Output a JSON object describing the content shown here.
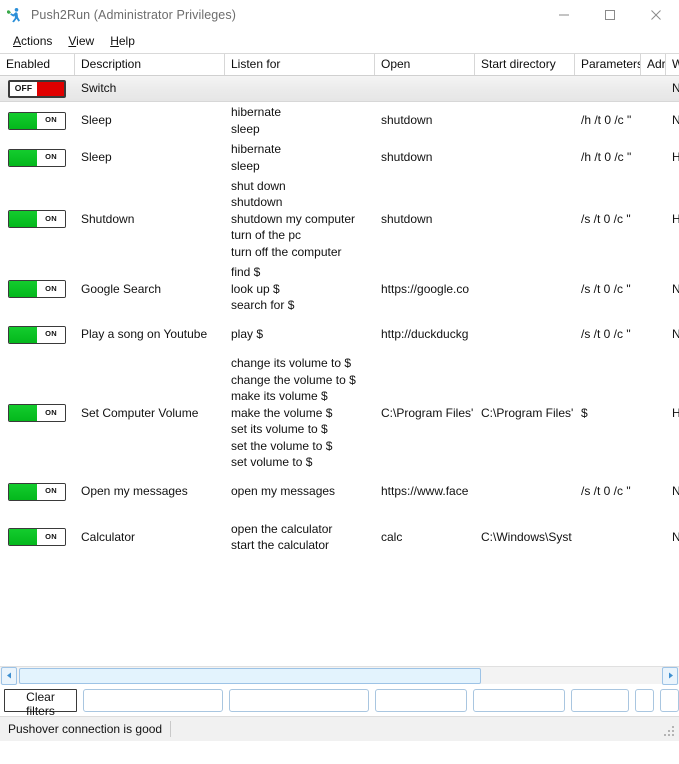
{
  "window": {
    "title": "Push2Run (Administrator Privileges)",
    "icon": "running-person-icon",
    "minimize_label": "–",
    "maximize_label": "□",
    "close_label": "✕"
  },
  "menu": {
    "items": [
      {
        "label": "Actions",
        "accel": "A"
      },
      {
        "label": "View",
        "accel": "V"
      },
      {
        "label": "Help",
        "accel": "H"
      }
    ]
  },
  "grid": {
    "columns": [
      {
        "key": "enabled",
        "label": "Enabled",
        "width": 75
      },
      {
        "key": "description",
        "label": "Description",
        "width": 150
      },
      {
        "key": "listen_for",
        "label": "Listen for",
        "width": 150
      },
      {
        "key": "open",
        "label": "Open",
        "width": 100
      },
      {
        "key": "start_directory",
        "label": "Start directory",
        "width": 100
      },
      {
        "key": "parameters",
        "label": "Parameters",
        "width": 66
      },
      {
        "key": "admin",
        "label": "Adr",
        "width": 25
      },
      {
        "key": "window_state",
        "label": "W",
        "width": 13
      }
    ],
    "rows": [
      {
        "enabled": "OFF",
        "enabled_state": "off",
        "description": "Switch",
        "listen_for": "",
        "open": "",
        "start_directory": "",
        "parameters": "",
        "admin": "",
        "window_state": "N",
        "height": 26,
        "is_switch_row": true
      },
      {
        "enabled": "ON",
        "enabled_state": "on",
        "description": "Sleep",
        "listen_for": "hibernate\nsleep",
        "open": "shutdown",
        "start_directory": "",
        "parameters": "/h /t 0 /c \"",
        "admin": "",
        "window_state": "N",
        "height": 37
      },
      {
        "enabled": "ON",
        "enabled_state": "on",
        "description": "Sleep",
        "listen_for": "hibernate\nsleep",
        "open": "shutdown",
        "start_directory": "",
        "parameters": "/h /t 0 /c \"",
        "admin": "",
        "window_state": "H",
        "height": 37
      },
      {
        "enabled": "ON",
        "enabled_state": "on",
        "description": "Shutdown",
        "listen_for": "shut down\nshutdown\nshutdown my computer\nturn of the pc\nturn off the computer",
        "open": "shutdown",
        "start_directory": "",
        "parameters": "/s /t 0 /c \"",
        "admin": "",
        "window_state": "H",
        "height": 86
      },
      {
        "enabled": "ON",
        "enabled_state": "on",
        "description": "Google Search",
        "listen_for": "find $\nlook up $\nsearch for $",
        "open": "https://google.co",
        "start_directory": "",
        "parameters": "/s /t 0 /c \"",
        "admin": "",
        "window_state": "N",
        "height": 54
      },
      {
        "enabled": "ON",
        "enabled_state": "on",
        "description": "Play a song on Youtube",
        "listen_for": "play $",
        "open": "http://duckduckg",
        "start_directory": "",
        "parameters": "/s /t 0 /c \"",
        "admin": "",
        "window_state": "N",
        "height": 37
      },
      {
        "enabled": "ON",
        "enabled_state": "on",
        "description": "Set Computer Volume",
        "listen_for": "change its volume to $\nchange the volume to $\nmake its volume $\nmake the volume $\nset its volume to $\nset the volume to $\nset volume to $",
        "open": "C:\\Program Files'",
        "start_directory": "C:\\Program Files'",
        "parameters": "$",
        "admin": "",
        "window_state": "H",
        "height": 120
      },
      {
        "enabled": "ON",
        "enabled_state": "on",
        "description": "Open my messages",
        "listen_for": "open my messages",
        "open": "https://www.face",
        "start_directory": "",
        "parameters": "/s /t 0 /c \"",
        "admin": "",
        "window_state": "N",
        "height": 37
      },
      {
        "enabled": "ON",
        "enabled_state": "on",
        "description": "Calculator",
        "listen_for": "open the calculator\nstart the calculator",
        "open": "calc",
        "start_directory": "C:\\Windows\\Syst",
        "parameters": "",
        "admin": "",
        "window_state": "N",
        "height": 54
      }
    ]
  },
  "scrollbar": {
    "left_arrow": "left-arrow-icon",
    "right_arrow": "right-arrow-icon",
    "thumb_fraction": 0.72
  },
  "filters": {
    "clear_label": "Clear filters",
    "inputs": [
      {
        "name": "filter-description",
        "value": "",
        "placeholder": "",
        "width": 140
      },
      {
        "name": "filter-listen-for",
        "value": "",
        "placeholder": "",
        "width": 140
      },
      {
        "name": "filter-open",
        "value": "",
        "placeholder": "",
        "width": 92
      },
      {
        "name": "filter-start-directory",
        "value": "",
        "placeholder": "",
        "width": 92
      },
      {
        "name": "filter-parameters",
        "value": "",
        "placeholder": "",
        "width": 58
      },
      {
        "name": "filter-admin",
        "value": "",
        "placeholder": "",
        "width": 19
      },
      {
        "name": "filter-window-state",
        "value": "",
        "placeholder": "",
        "width": 19
      }
    ]
  },
  "status": {
    "message": "Pushover connection is good"
  },
  "colors": {
    "toggle_on": "#0cc226",
    "toggle_off": "#e00000",
    "accent_border": "#a9c6e0",
    "title_text": "#6d6d6d"
  }
}
